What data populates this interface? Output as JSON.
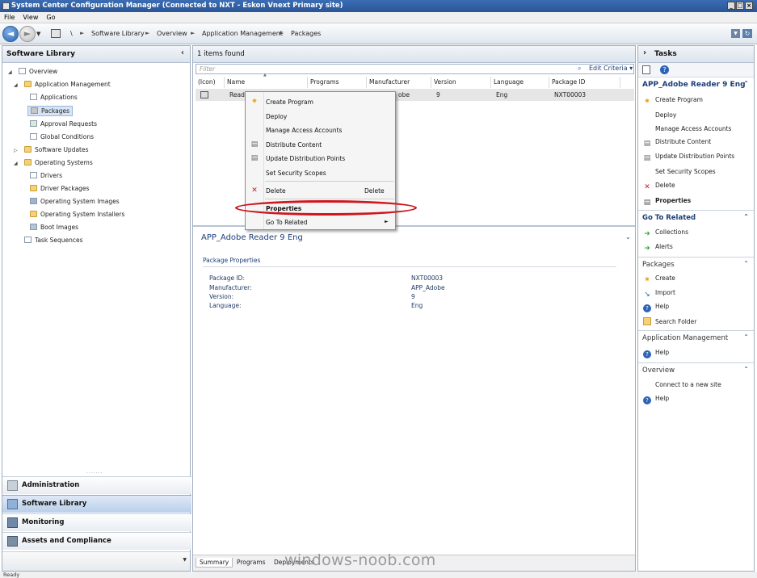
{
  "window": {
    "title": "System Center Configuration Manager (Connected to NXT - Eskon Vnext Primary site)"
  },
  "menu": [
    "File",
    "View",
    "Go"
  ],
  "breadcrumb": [
    "\\",
    "Software Library",
    "Overview",
    "Application Management",
    "Packages"
  ],
  "left": {
    "title": "Software Library",
    "tree": [
      {
        "label": "Overview"
      },
      {
        "label": "Application Management"
      },
      {
        "label": "Applications"
      },
      {
        "label": "Packages"
      },
      {
        "label": "Approval Requests"
      },
      {
        "label": "Global Conditions"
      },
      {
        "label": "Software Updates"
      },
      {
        "label": "Operating Systems"
      },
      {
        "label": "Drivers"
      },
      {
        "label": "Driver Packages"
      },
      {
        "label": "Operating System Images"
      },
      {
        "label": "Operating System Installers"
      },
      {
        "label": "Boot Images"
      },
      {
        "label": "Task Sequences"
      }
    ],
    "wunderbar": [
      "Administration",
      "Software Library",
      "Monitoring",
      "Assets and Compliance"
    ]
  },
  "middle": {
    "count_label": "1 items found",
    "filter_placeholder": "Filter",
    "edit_criteria": "Edit Criteria",
    "columns": [
      "(Icon)",
      "Name",
      "Programs",
      "Manufacturer",
      "Version",
      "Language",
      "Package ID"
    ],
    "row": {
      "name": "Reade",
      "manufacturer": "obe",
      "version": "9",
      "language": "Eng",
      "package_id": "NXT00003"
    },
    "detail": {
      "title": "APP_Adobe Reader 9 Eng",
      "section": "Package Properties",
      "fields": [
        {
          "label": "Package ID:",
          "value": "NXT00003"
        },
        {
          "label": "Manufacturer:",
          "value": "APP_Adobe"
        },
        {
          "label": "Version:",
          "value": "9"
        },
        {
          "label": "Language:",
          "value": "Eng"
        }
      ]
    },
    "tabs": [
      "Summary",
      "Programs",
      "Deployments"
    ]
  },
  "context_menu": {
    "items": [
      "Create Program",
      "Deploy",
      "Manage Access Accounts",
      "Distribute Content",
      "Update Distribution Points",
      "Set Security Scopes",
      "Delete",
      "Properties",
      "Go To Related"
    ],
    "delete_shortcut": "Delete"
  },
  "right": {
    "title": "Tasks",
    "package_title": "APP_Adobe Reader 9 Eng",
    "package_actions": [
      "Create Program",
      "Deploy",
      "Manage Access Accounts",
      "Distribute Content",
      "Update Distribution Points",
      "Set Security Scopes",
      "Delete",
      "Properties"
    ],
    "go_to_related": "Go To Related",
    "related": [
      "Collections",
      "Alerts"
    ],
    "packages_title": "Packages",
    "packages_actions": [
      "Create",
      "Import",
      "Help",
      "Search Folder"
    ],
    "appmgmt_title": "Application Management",
    "appmgmt_actions": [
      "Help"
    ],
    "overview_title": "Overview",
    "overview_actions": [
      "Connect to a new site",
      "Help"
    ]
  },
  "status": "Ready",
  "watermark": "windows-noob.com",
  "colors": {
    "accent": "#1c3f78",
    "highlight_oval": "#d0151d",
    "selected": "#c9daf0"
  }
}
